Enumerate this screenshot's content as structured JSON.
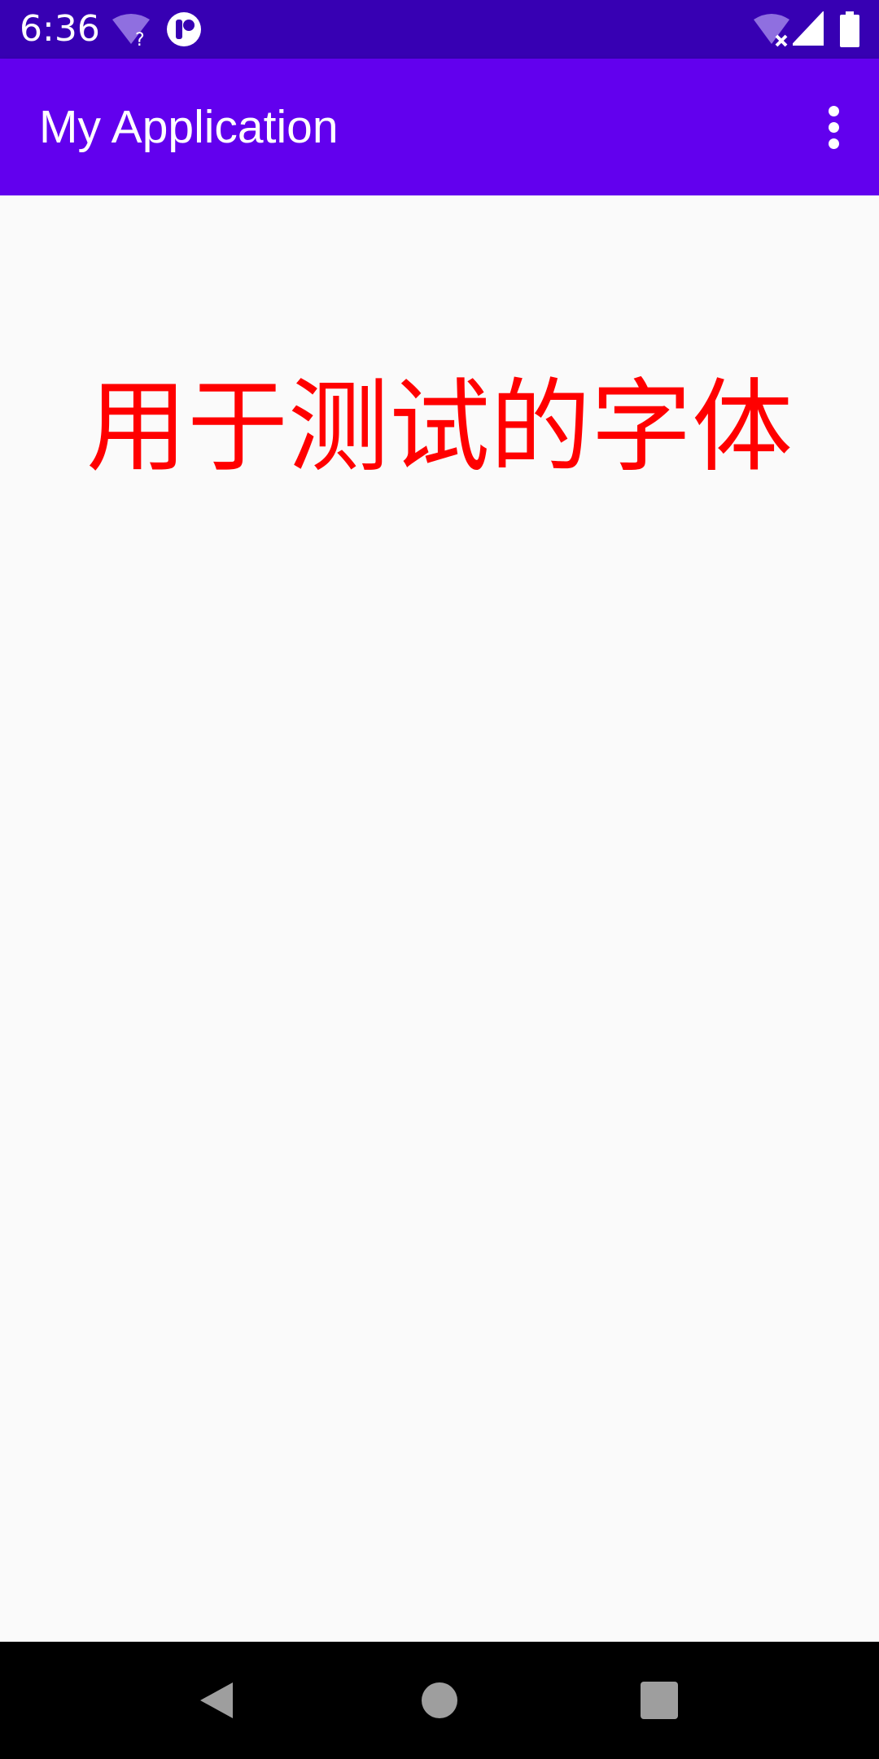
{
  "status_bar": {
    "time": "6:36",
    "wifi_unknown_icon": "wifi-question-icon",
    "notification_icon": "notification-icon",
    "wifi_off_icon": "wifi-off-icon",
    "signal_icon": "cell-signal-icon",
    "battery_icon": "battery-icon"
  },
  "app_bar": {
    "title": "My Application",
    "menu_icon": "more-vert-icon"
  },
  "main": {
    "text": "用于测试的字体",
    "text_color": "#ff0000"
  },
  "nav_bar": {
    "back_icon": "back-icon",
    "home_icon": "home-icon",
    "recents_icon": "recents-icon"
  },
  "colors": {
    "status_bar": "#3700b3",
    "app_bar": "#6200ee",
    "background": "#fafafa",
    "nav_bar": "#000000"
  }
}
